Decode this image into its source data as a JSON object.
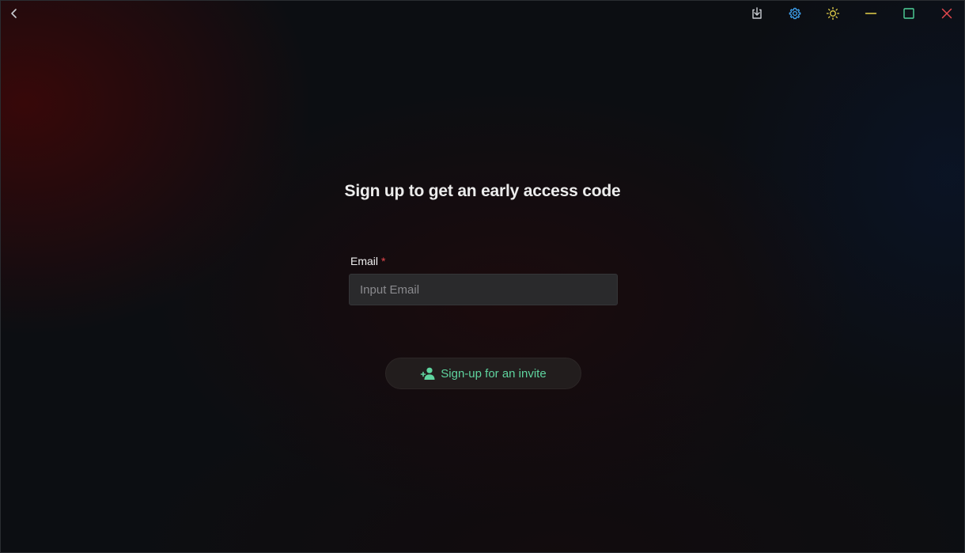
{
  "titlebar": {
    "icons": {
      "back": "chevron-left-icon",
      "download": "download-icon",
      "settings": "gear-icon",
      "theme": "sun-icon",
      "minimize": "minimize-icon",
      "maximize": "maximize-icon",
      "close": "close-icon"
    },
    "colors": {
      "back": "#c9ccd1",
      "download": "#c9ccd1",
      "settings": "#3fa2f0",
      "theme": "#e6d24a",
      "minimize": "#e6d24a",
      "maximize": "#4fd39a",
      "close": "#e5484d"
    }
  },
  "form": {
    "heading": "Sign up to get an early access code",
    "email": {
      "label": "Email",
      "required_mark": "*",
      "placeholder": "Input Email",
      "value": ""
    },
    "submit": {
      "label": "Sign-up for an invite",
      "icon": "person-add-icon",
      "color": "#5fd49f"
    }
  }
}
